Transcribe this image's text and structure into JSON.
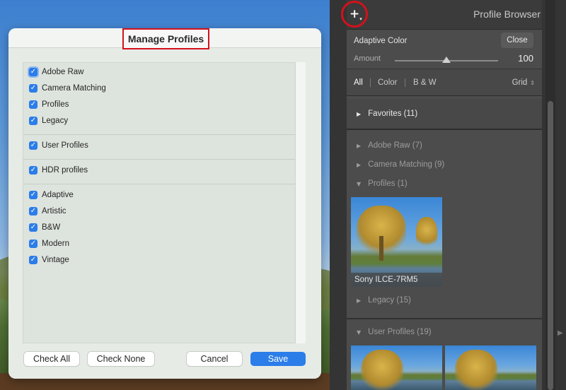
{
  "dialog": {
    "title": "Manage Profiles",
    "groups": [
      [
        {
          "label": "Adobe Raw",
          "checked": true,
          "focused": true
        },
        {
          "label": "Camera Matching",
          "checked": true
        },
        {
          "label": "Profiles",
          "checked": true
        },
        {
          "label": "Legacy",
          "checked": true
        }
      ],
      [
        {
          "label": "User Profiles",
          "checked": true
        }
      ],
      [
        {
          "label": "HDR profiles",
          "checked": true
        }
      ],
      [
        {
          "label": "Adaptive",
          "checked": true
        },
        {
          "label": "Artistic",
          "checked": true
        },
        {
          "label": "B&W",
          "checked": true
        },
        {
          "label": "Modern",
          "checked": true
        },
        {
          "label": "Vintage",
          "checked": true
        }
      ]
    ],
    "buttons": {
      "check_all": "Check All",
      "check_none": "Check None",
      "cancel": "Cancel",
      "save": "Save"
    }
  },
  "browser": {
    "title": "Profile Browser",
    "add_icon": "plus-icon",
    "adaptive": {
      "title": "Adaptive Color",
      "close_label": "Close",
      "amount_label": "Amount",
      "amount_value": "100",
      "amount_fraction": 0.5
    },
    "filters": [
      {
        "label": "All",
        "active": true
      },
      {
        "label": "Color",
        "active": false
      },
      {
        "label": "B & W",
        "active": false
      }
    ],
    "view_mode": "Grid",
    "favorites": {
      "label": "Favorites (11)",
      "expanded": false
    },
    "groups": [
      {
        "label": "Adobe Raw (7)",
        "expanded": false
      },
      {
        "label": "Camera Matching (9)",
        "expanded": false
      },
      {
        "label": "Profiles (1)",
        "expanded": true
      },
      {
        "label": "Legacy (15)",
        "expanded": false
      },
      {
        "label": "User Profiles (19)",
        "expanded": true
      }
    ],
    "profile_thumb_caption": "Sony ILCE-7RM5"
  },
  "colors": {
    "accent": "#2b7de9",
    "highlight": "#d4111c",
    "panel": "#4b4c4b"
  }
}
